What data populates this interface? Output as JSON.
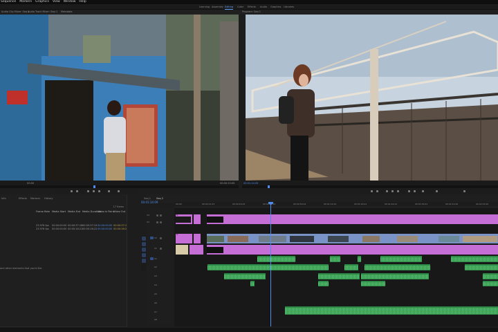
{
  "menu": [
    "Sequence",
    "Markers",
    "Graphics",
    "View",
    "Window",
    "Help"
  ],
  "workspaces": {
    "tabs": [
      "Learning",
      "Assembly",
      "Editing",
      "Color",
      "Effects",
      "Audio",
      "Graphics",
      "Libraries"
    ],
    "active_index": 2
  },
  "source_panel": {
    "tabs": [
      "Audio Clip Mixer: Seq 1",
      "Audio Track Mixer: Seq 1",
      "Metadata"
    ],
    "timecode_left": "00:00",
    "duration": "00:00:15:05",
    "playhead_fraction": 0.39
  },
  "program_panel": {
    "title": "Program: Seq 1",
    "timecode": "00:01:14:09",
    "playhead_fraction": 0.1
  },
  "project_panel": {
    "tabs": [
      "Info",
      "Effects",
      "Markers",
      "History"
    ],
    "items_count": "17 Items",
    "columns": [
      "Frame Rate",
      "Media Start",
      "Media End",
      "Media Duration",
      "Video In Point",
      "Video Out"
    ],
    "rows": [
      [
        "23.976 fps",
        "00:00:00:00",
        "00:00:37:18",
        "00:00:37:19",
        "00:00:00:00",
        "00:00:37:1"
      ],
      [
        "23.976 fps",
        "00:00:00:00",
        "00:00:16:21",
        "00:00:16:22",
        "00:00:00:00",
        "00:00:16:2"
      ]
    ],
    "drop_hint": "and other elements that you'd like"
  },
  "timeline": {
    "tabs": [
      "Seq 1",
      "Seq 2"
    ],
    "active_tab": 1,
    "timecode": "00:01:14:09",
    "ruler": [
      "00:00",
      "00:00:14:23",
      "00:00:29:23",
      "00:00:44:22",
      "00:00:59:22",
      "00:01:14:22",
      "00:01:29:21",
      "00:01:44:21",
      "00:01:59:21",
      "00:02:14:20",
      "00:02:29:20",
      "00:02:44:19",
      "00:02:59:19",
      "00:03:14:18"
    ],
    "track_labels": [
      "V4",
      "V3",
      "V2",
      "V1",
      "A1",
      "A2",
      "A3",
      "A4",
      "A5",
      "A6",
      "A7",
      "A8",
      "A9",
      "A10"
    ],
    "clip_tag": "fx"
  },
  "colors": {
    "accent": "#4f8cf0",
    "video_clip": "#c56fd6",
    "video_clip_alt": "#7a93c7",
    "audio_clip": "#2d8a47"
  },
  "icons": [
    "play-icon",
    "step-back-icon",
    "step-forward-icon",
    "mark-in-icon",
    "mark-out-icon",
    "export-frame-icon",
    "wrench-icon",
    "selection-tool-icon",
    "razor-tool-icon",
    "pen-tool-icon",
    "hand-tool-icon",
    "type-tool-icon"
  ]
}
